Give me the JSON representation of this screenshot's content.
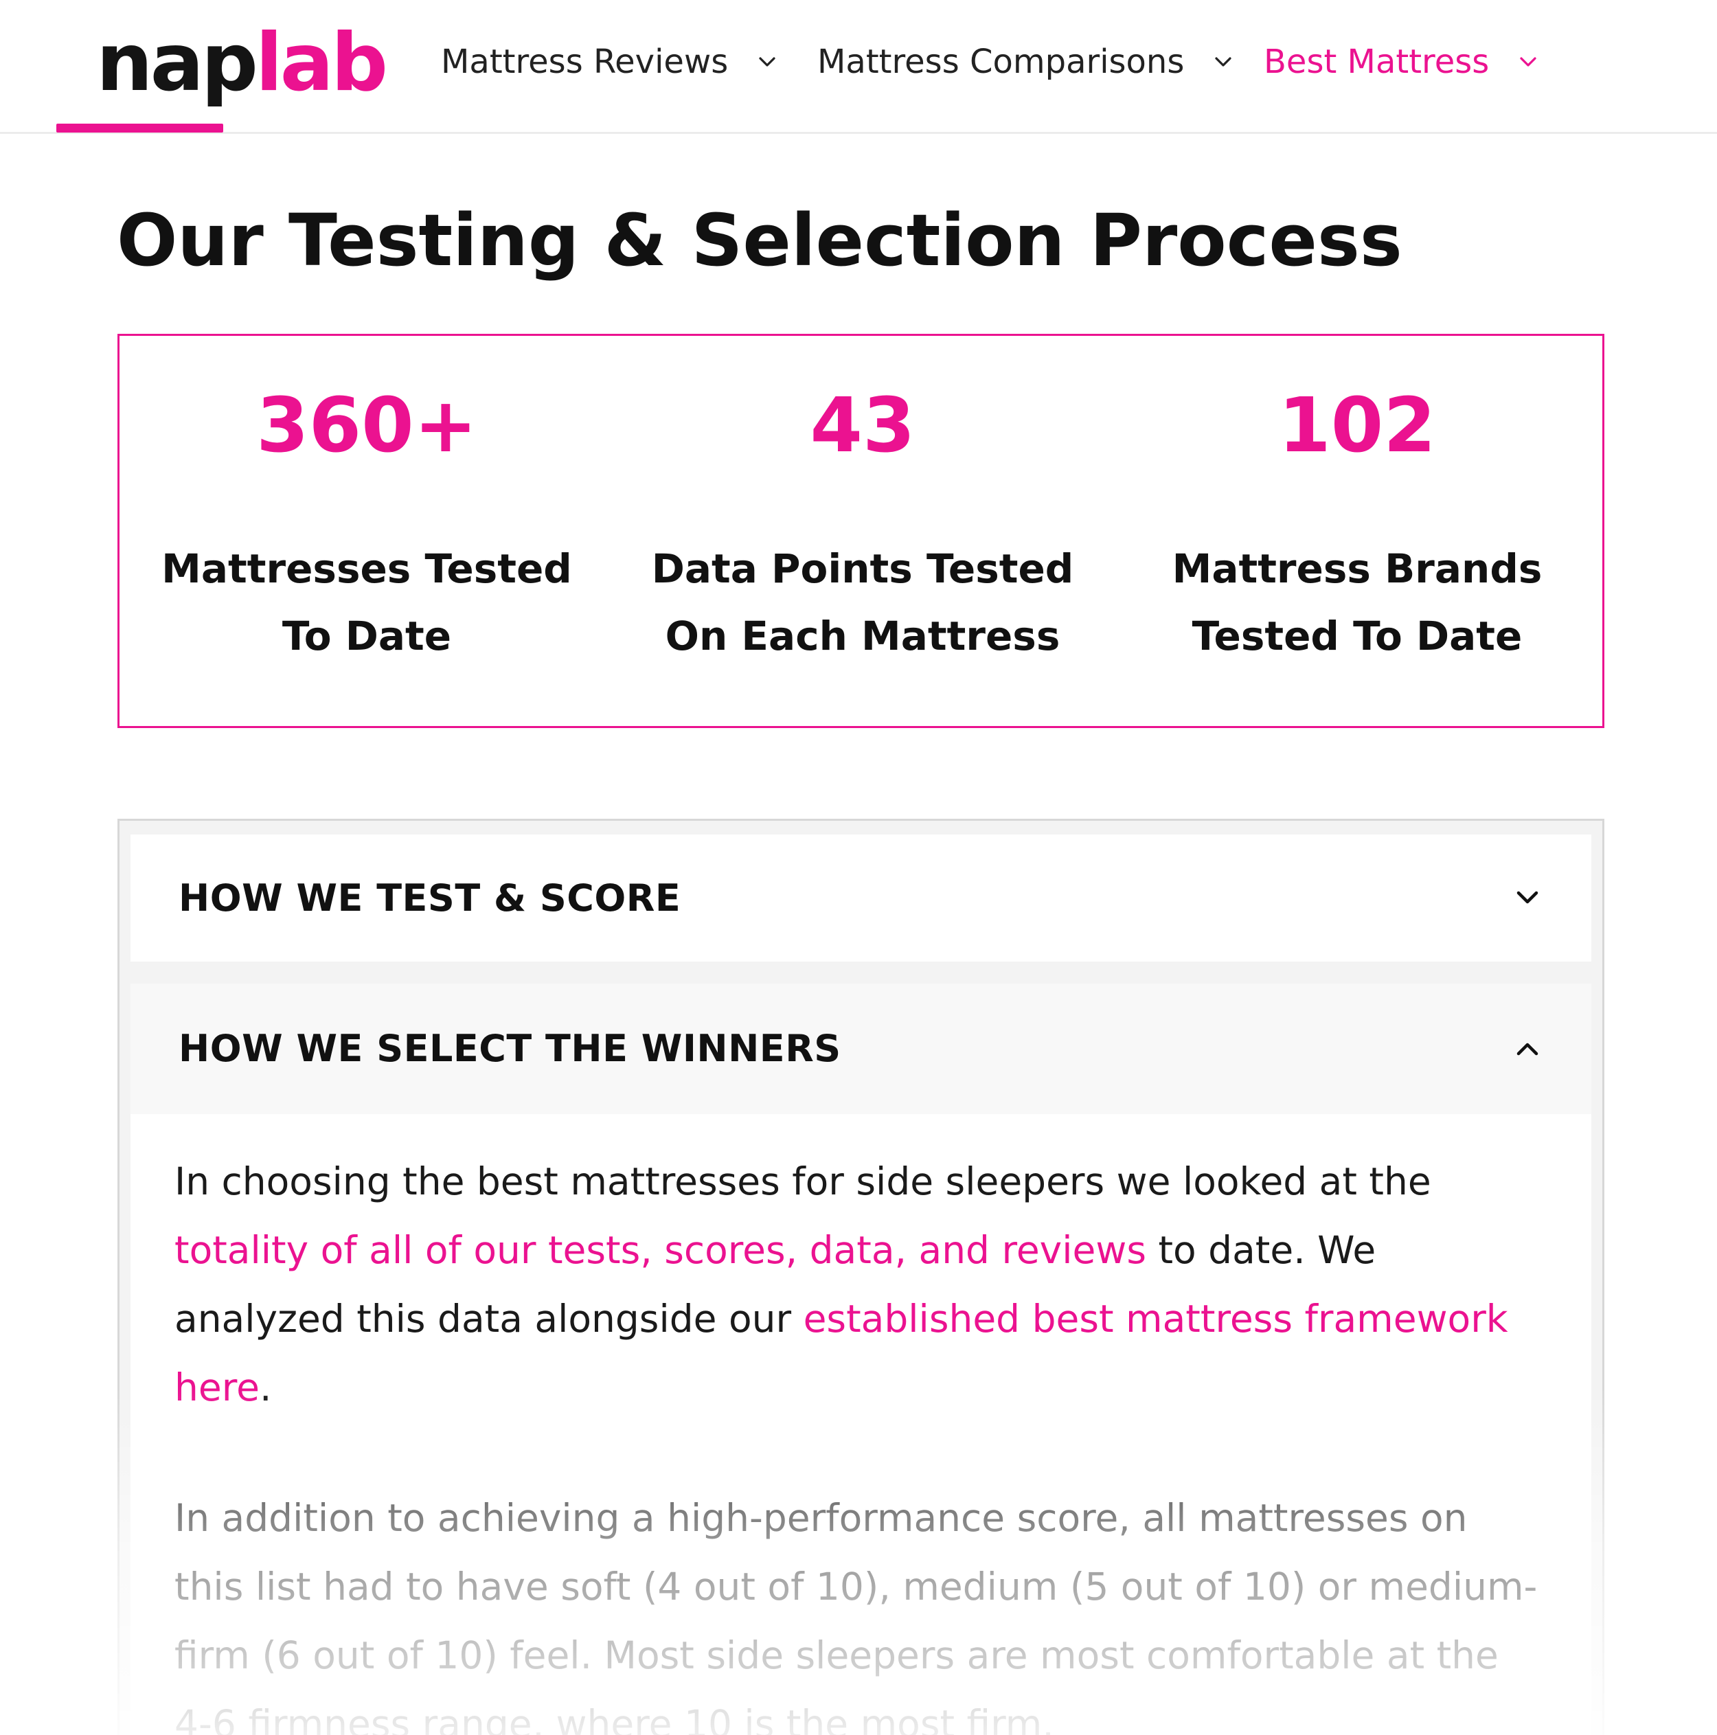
{
  "brand": {
    "logo_part1": "nap",
    "logo_part2": "lab",
    "accent_color": "#eb1290"
  },
  "nav": {
    "items": [
      {
        "label": "Mattress Reviews",
        "icon": "chevron-down-icon",
        "active": false
      },
      {
        "label": "Mattress Comparisons",
        "icon": "chevron-down-icon",
        "active": false
      },
      {
        "label": "Best Mattress",
        "icon": "chevron-down-icon",
        "active": true
      }
    ]
  },
  "page": {
    "title": "Our Testing & Selection Process"
  },
  "stats": [
    {
      "value": "360+",
      "label_line1": "Mattresses Tested",
      "label_line2": "To Date"
    },
    {
      "value": "43",
      "label_line1": "Data Points Tested",
      "label_line2": "On Each Mattress"
    },
    {
      "value": "102",
      "label_line1": "Mattress Brands",
      "label_line2": "Tested To Date"
    }
  ],
  "accordion": {
    "items": [
      {
        "title": "HOW WE TEST & SCORE",
        "expanded": false,
        "icon": "chevron-down-icon"
      },
      {
        "title": "HOW WE SELECT THE WINNERS",
        "expanded": true,
        "icon": "chevron-up-icon"
      }
    ],
    "body": {
      "p1_text1": "In choosing the best mattresses for side sleepers we looked at the ",
      "p1_link1": "totality of all of our tests, scores, data, and reviews",
      "p1_text2": " to date. We analyzed this data alongside our ",
      "p1_link2": "established best mattress framework here",
      "p1_text3": ".",
      "p2": "In addition to achieving a high-performance score, all mattresses on this list had to have soft (4 out of 10), medium (5 out of 10) or medium-firm (6 out of 10) feel. Most side sleepers are most comfortable at the 4-6 firmness range, where 10 is the most firm."
    }
  }
}
